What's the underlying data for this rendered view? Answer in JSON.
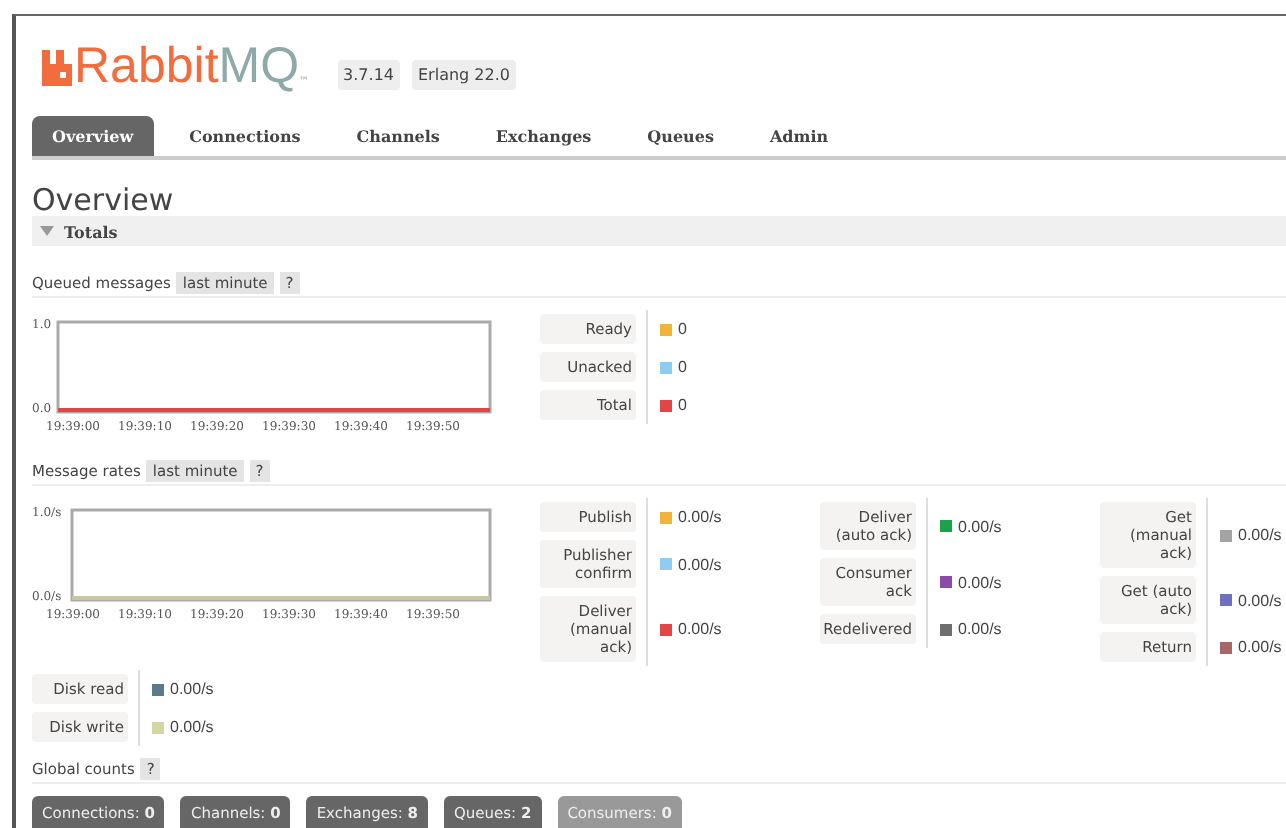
{
  "logo": {
    "name": "Rabbit",
    "suffix": "MQ",
    "mark": "™"
  },
  "versions": [
    "3.7.14",
    "Erlang 22.0"
  ],
  "tabs": [
    {
      "label": "Overview",
      "selected": true
    },
    {
      "label": "Connections",
      "selected": false
    },
    {
      "label": "Channels",
      "selected": false
    },
    {
      "label": "Exchanges",
      "selected": false
    },
    {
      "label": "Queues",
      "selected": false
    },
    {
      "label": "Admin",
      "selected": false
    }
  ],
  "page_title": "Overview",
  "section": {
    "title": "Totals",
    "expanded": true
  },
  "queued": {
    "label": "Queued messages",
    "range": "last minute",
    "help": "?",
    "chart_data": {
      "type": "line",
      "categories": [
        "19:39:00",
        "19:39:10",
        "19:39:20",
        "19:39:30",
        "19:39:40",
        "19:39:50",
        null
      ],
      "ylim": [
        0,
        1
      ],
      "yticks": [
        {
          "value": 0,
          "label": "0.0"
        },
        {
          "value": 1,
          "label": "1.0"
        }
      ],
      "series": [
        {
          "color": "#e24545",
          "values": [
            0,
            0,
            0,
            0,
            0,
            0,
            0
          ]
        }
      ]
    },
    "legend": [
      [
        {
          "label": "Ready",
          "color": "#f0b43a",
          "value": "0"
        },
        {
          "label": "Unacked",
          "color": "#8fcdf0",
          "value": "0"
        },
        {
          "label": "Total",
          "color": "#e24545",
          "value": "0"
        }
      ]
    ]
  },
  "rates": {
    "label": "Message rates",
    "range": "last minute",
    "help": "?",
    "chart_data": {
      "type": "line",
      "categories": [
        "19:39:00",
        "19:39:10",
        "19:39:20",
        "19:39:30",
        "19:39:40",
        "19:39:50",
        null
      ],
      "ylim": [
        0,
        1
      ],
      "yticks": [
        {
          "value": 0,
          "label": "0.0/s"
        },
        {
          "value": 1,
          "label": "1.0/s"
        }
      ],
      "series": [
        {
          "color": "#c8c6a4",
          "values": [
            0,
            0,
            0,
            0,
            0,
            0,
            0
          ]
        }
      ]
    },
    "legend": [
      [
        {
          "label": "Publish",
          "color": "#f0b43a",
          "value": "0.00/s"
        },
        {
          "label": "Publisher confirm",
          "color": "#8fcdf0",
          "value": "0.00/s"
        },
        {
          "label": "Deliver (manual ack)",
          "color": "#e24545",
          "value": "0.00/s"
        }
      ],
      [
        {
          "label": "Deliver (auto ack)",
          "color": "#1aa34a",
          "value": "0.00/s"
        },
        {
          "label": "Consumer ack",
          "color": "#8a4aa8",
          "value": "0.00/s"
        },
        {
          "label": "Redelivered",
          "color": "#6e6e6e",
          "value": "0.00/s"
        }
      ],
      [
        {
          "label": "Get (manual ack)",
          "color": "#a3a3a3",
          "value": "0.00/s"
        },
        {
          "label": "Get (auto ack)",
          "color": "#7070c0",
          "value": "0.00/s"
        },
        {
          "label": "Return",
          "color": "#a86868",
          "value": "0.00/s"
        }
      ]
    ]
  },
  "disk": [
    {
      "label": "Disk read",
      "color": "#5a7a8e",
      "value": "0.00/s"
    },
    {
      "label": "Disk write",
      "color": "#d4d6a4",
      "value": "0.00/s"
    }
  ],
  "global_counts": {
    "label": "Global counts",
    "help": "?",
    "items": [
      {
        "label": "Connections:",
        "value": "0",
        "muted": false
      },
      {
        "label": "Channels:",
        "value": "0",
        "muted": false
      },
      {
        "label": "Exchanges:",
        "value": "8",
        "muted": false
      },
      {
        "label": "Queues:",
        "value": "2",
        "muted": false
      },
      {
        "label": "Consumers:",
        "value": "0",
        "muted": true
      }
    ]
  }
}
